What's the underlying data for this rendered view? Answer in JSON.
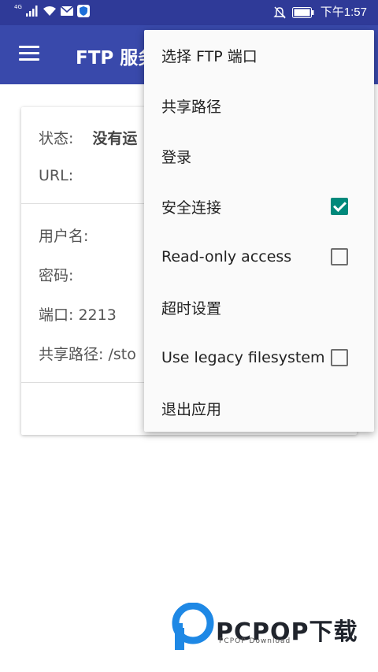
{
  "status_bar": {
    "network_type": "4G",
    "time": "下午1:57"
  },
  "app_bar": {
    "title": "FTP 服务"
  },
  "card": {
    "status_label": "状态:",
    "status_value": "没有运",
    "url_label": "URL:",
    "username_label": "用户名:",
    "password_label": "密码:",
    "port_text": "端口: 2213",
    "share_path_text": "共享路径: /sto"
  },
  "menu": {
    "items": [
      {
        "label": "选择 FTP 端口"
      },
      {
        "label": "共享路径"
      },
      {
        "label": "登录"
      },
      {
        "label": "安全连接",
        "checked": true
      },
      {
        "label": "Read-only access",
        "checked": false
      },
      {
        "label": "超时设置"
      },
      {
        "label": "Use legacy filesystem",
        "checked": false
      },
      {
        "label": "退出应用"
      }
    ]
  },
  "watermark": {
    "brand": "PCPOP下载",
    "sub": "PCPOP Download"
  },
  "colors": {
    "app_bar": "#3949ab",
    "status_bar": "#2f3a98",
    "accent": "#00897b",
    "watermark_blue": "#1e88e5"
  }
}
